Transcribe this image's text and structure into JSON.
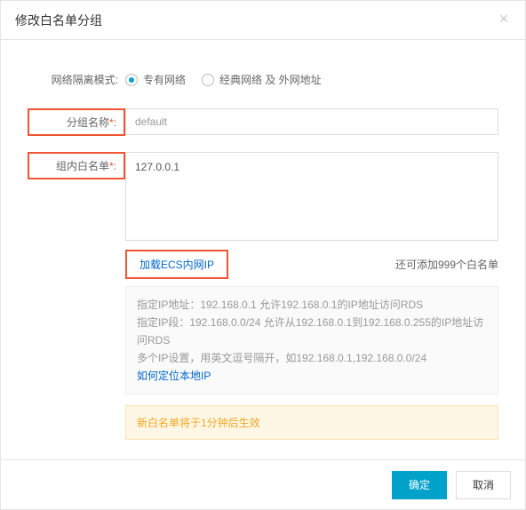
{
  "dialog": {
    "title": "修改白名单分组",
    "close_label": "×",
    "ok_label": "确定",
    "cancel_label": "取消"
  },
  "form": {
    "network_mode": {
      "label": "网络隔离模式:",
      "options": [
        {
          "label": "专有网络",
          "checked": true
        },
        {
          "label": "经典网络 及 外网地址",
          "checked": false
        }
      ]
    },
    "group_name": {
      "label_text": "分组名称",
      "value": "default"
    },
    "whitelist": {
      "label_text": "组内白名单",
      "value": "127.0.0.1",
      "load_ecs_link": "加载ECS内网IP",
      "remaining_text": "还可添加999个白名单",
      "tips": {
        "l1": "指定IP地址：192.168.0.1 允许192.168.0.1的IP地址访问RDS",
        "l2": "指定IP段：192.168.0.0/24 允许从192.168.0.1到192.168.0.255的IP地址访问RDS",
        "l3": "多个IP设置，用英文逗号隔开，如192.168.0.1,192.168.0.0/24",
        "local_ip_link": "如何定位本地IP"
      },
      "warn_text": "新白名单将于1分钟后生效"
    }
  }
}
